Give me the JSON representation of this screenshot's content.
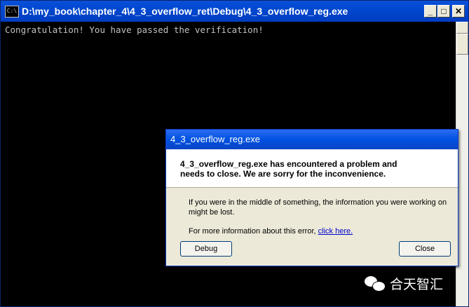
{
  "console": {
    "title": "D:\\my_book\\chapter_4\\4_3_overflow_ret\\Debug\\4_3_overflow_reg.exe",
    "icon_text": "C:\\",
    "output": "Congratulation! You have passed the verification!"
  },
  "dialog": {
    "title": "4_3_overflow_reg.exe",
    "header_line1": "4_3_overflow_reg.exe has encountered a problem and",
    "header_line2": "needs to close.  We are sorry for the inconvenience.",
    "body_line1": "If you were in the middle of something, the information you were working on",
    "body_line2": "might be lost.",
    "more_info": "For more information about this error, ",
    "link": "click here.",
    "debug_label": "Debug",
    "close_label": "Close"
  },
  "watermark": {
    "text": "合天智汇"
  }
}
